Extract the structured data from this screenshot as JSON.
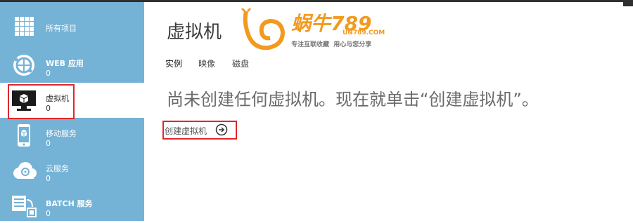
{
  "sidebar": {
    "items": [
      {
        "label": "所有项目",
        "count": "",
        "icon": "grid-icon"
      },
      {
        "label": "WEB 应用",
        "count": "0",
        "icon": "globe-icon"
      },
      {
        "label": "虚拟机",
        "count": "0",
        "icon": "monitor-icon",
        "selected": true
      },
      {
        "label": "移动服务",
        "count": "0",
        "icon": "mobile-icon"
      },
      {
        "label": "云服务",
        "count": "0",
        "icon": "cloud-gear-icon"
      },
      {
        "label": "BATCH 服务",
        "count": "0",
        "icon": "batch-icon"
      }
    ]
  },
  "main": {
    "title": "虚拟机",
    "tabs": [
      {
        "label": "实例",
        "active": true
      },
      {
        "label": "映像",
        "active": false
      },
      {
        "label": "磁盘",
        "active": false
      }
    ],
    "empty_message": "尚未创建任何虚拟机。现在就单击“创建虚拟机”。",
    "create_link": {
      "label": "创建虚拟机",
      "icon": "arrow-right-circle-icon"
    }
  },
  "watermark": {
    "text": "蜗牛789",
    "domain": "UN789.COM",
    "slogan": "专注互联收藏  用心与您分享"
  },
  "colors": {
    "sidebar_bg": "#74b2d6",
    "highlight": "#e0262b",
    "logo_orange": "#f39a1e"
  }
}
